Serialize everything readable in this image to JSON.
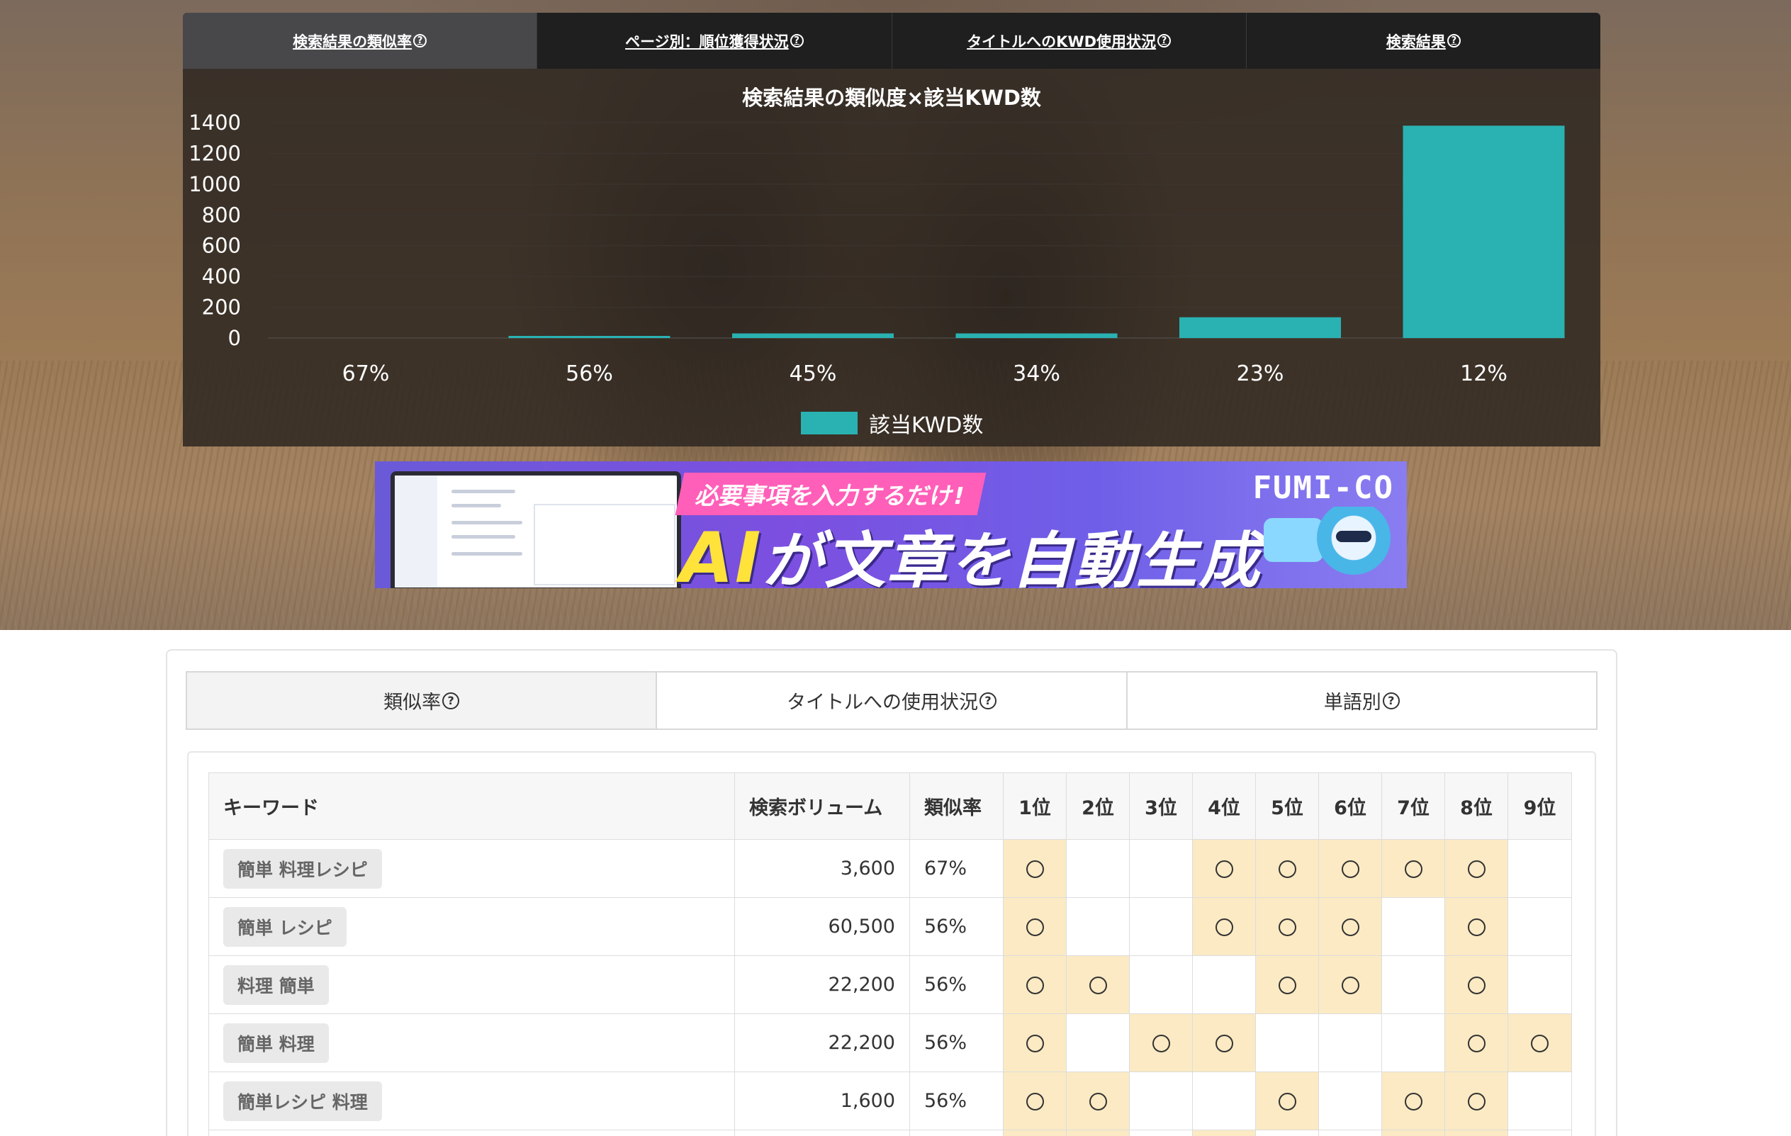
{
  "top_tabs": [
    {
      "label": "検索結果の類似率",
      "active": true
    },
    {
      "label": "ページ別：順位獲得状況",
      "active": false
    },
    {
      "label": "タイトルへのKWD使用状況",
      "active": false
    },
    {
      "label": "検索結果",
      "active": false
    }
  ],
  "help_icon": "?",
  "chart_data": {
    "type": "bar",
    "title": "検索結果の類似度×該当KWD数",
    "categories": [
      "67%",
      "56%",
      "45%",
      "34%",
      "23%",
      "12%"
    ],
    "series": [
      {
        "name": "該当KWD数",
        "values": [
          0,
          10,
          30,
          30,
          135,
          1380
        ],
        "color": "#2ab2b2"
      }
    ],
    "y_ticks": [
      1400,
      1200,
      1000,
      800,
      600,
      400,
      200,
      0
    ],
    "ylim": [
      0,
      1400
    ],
    "grid": true,
    "legend": "bottom-center"
  },
  "banner": {
    "tagline": "必要事項を入力するだけ!",
    "headline_ai": "AI",
    "headline_rest": "が文章を自動生成",
    "logo": "FUMI-CO"
  },
  "sub_tabs": [
    {
      "label": "類似率",
      "active": true
    },
    {
      "label": "タイトルへの使用状況",
      "active": false
    },
    {
      "label": "単語別",
      "active": false
    }
  ],
  "table": {
    "headers": {
      "keyword": "キーワード",
      "volume": "検索ボリューム",
      "similarity": "類似率",
      "ranks": [
        "1位",
        "2位",
        "3位",
        "4位",
        "5位",
        "6位",
        "7位",
        "8位",
        "9位"
      ]
    },
    "rows": [
      {
        "keyword": "簡単 料理レシピ",
        "volume": "3,600",
        "similarity": "67%",
        "hits": [
          1,
          0,
          0,
          1,
          1,
          1,
          1,
          1,
          0
        ]
      },
      {
        "keyword": "簡単 レシピ",
        "volume": "60,500",
        "similarity": "56%",
        "hits": [
          1,
          0,
          0,
          1,
          1,
          1,
          0,
          1,
          0
        ]
      },
      {
        "keyword": "料理 簡単",
        "volume": "22,200",
        "similarity": "56%",
        "hits": [
          1,
          1,
          0,
          0,
          1,
          1,
          0,
          1,
          0
        ]
      },
      {
        "keyword": "簡単 料理",
        "volume": "22,200",
        "similarity": "56%",
        "hits": [
          1,
          0,
          1,
          1,
          0,
          0,
          0,
          1,
          1
        ]
      },
      {
        "keyword": "簡単レシピ 料理",
        "volume": "1,600",
        "similarity": "56%",
        "hits": [
          1,
          1,
          0,
          0,
          1,
          0,
          1,
          1,
          0
        ]
      },
      {
        "keyword": "",
        "volume": "",
        "similarity": "",
        "hits": [
          1,
          1,
          0,
          1,
          0,
          0,
          1,
          1,
          0
        ]
      }
    ]
  }
}
